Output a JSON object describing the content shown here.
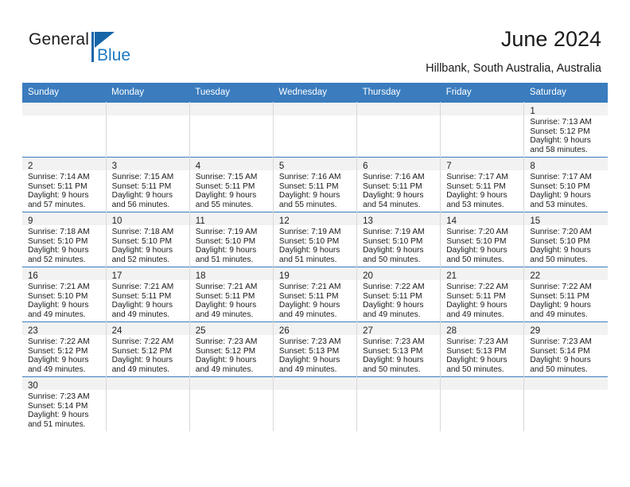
{
  "brand": {
    "word_one": "General",
    "word_two": "Blue",
    "triangle_icon": "triangle-logo-icon",
    "accent_dark": "#1565a8",
    "accent_light": "#1b79c4"
  },
  "header": {
    "title": "June 2024",
    "subtitle": "Hillbank, South Australia, Australia"
  },
  "calendar": {
    "header_bg": "#3a7cbe",
    "daynum_bg": "#f2f2f2",
    "weekday_headers": [
      "Sunday",
      "Monday",
      "Tuesday",
      "Wednesday",
      "Thursday",
      "Friday",
      "Saturday"
    ],
    "weeks": [
      [
        {
          "day": "",
          "sunrise": "",
          "sunset": "",
          "daylight_line1": "",
          "daylight_line2": "",
          "empty": true
        },
        {
          "day": "",
          "sunrise": "",
          "sunset": "",
          "daylight_line1": "",
          "daylight_line2": "",
          "empty": true
        },
        {
          "day": "",
          "sunrise": "",
          "sunset": "",
          "daylight_line1": "",
          "daylight_line2": "",
          "empty": true
        },
        {
          "day": "",
          "sunrise": "",
          "sunset": "",
          "daylight_line1": "",
          "daylight_line2": "",
          "empty": true
        },
        {
          "day": "",
          "sunrise": "",
          "sunset": "",
          "daylight_line1": "",
          "daylight_line2": "",
          "empty": true
        },
        {
          "day": "",
          "sunrise": "",
          "sunset": "",
          "daylight_line1": "",
          "daylight_line2": "",
          "empty": true
        },
        {
          "day": "1",
          "sunrise": "Sunrise: 7:13 AM",
          "sunset": "Sunset: 5:12 PM",
          "daylight_line1": "Daylight: 9 hours",
          "daylight_line2": "and 58 minutes.",
          "empty": false
        }
      ],
      [
        {
          "day": "2",
          "sunrise": "Sunrise: 7:14 AM",
          "sunset": "Sunset: 5:11 PM",
          "daylight_line1": "Daylight: 9 hours",
          "daylight_line2": "and 57 minutes.",
          "empty": false
        },
        {
          "day": "3",
          "sunrise": "Sunrise: 7:15 AM",
          "sunset": "Sunset: 5:11 PM",
          "daylight_line1": "Daylight: 9 hours",
          "daylight_line2": "and 56 minutes.",
          "empty": false
        },
        {
          "day": "4",
          "sunrise": "Sunrise: 7:15 AM",
          "sunset": "Sunset: 5:11 PM",
          "daylight_line1": "Daylight: 9 hours",
          "daylight_line2": "and 55 minutes.",
          "empty": false
        },
        {
          "day": "5",
          "sunrise": "Sunrise: 7:16 AM",
          "sunset": "Sunset: 5:11 PM",
          "daylight_line1": "Daylight: 9 hours",
          "daylight_line2": "and 55 minutes.",
          "empty": false
        },
        {
          "day": "6",
          "sunrise": "Sunrise: 7:16 AM",
          "sunset": "Sunset: 5:11 PM",
          "daylight_line1": "Daylight: 9 hours",
          "daylight_line2": "and 54 minutes.",
          "empty": false
        },
        {
          "day": "7",
          "sunrise": "Sunrise: 7:17 AM",
          "sunset": "Sunset: 5:11 PM",
          "daylight_line1": "Daylight: 9 hours",
          "daylight_line2": "and 53 minutes.",
          "empty": false
        },
        {
          "day": "8",
          "sunrise": "Sunrise: 7:17 AM",
          "sunset": "Sunset: 5:10 PM",
          "daylight_line1": "Daylight: 9 hours",
          "daylight_line2": "and 53 minutes.",
          "empty": false
        }
      ],
      [
        {
          "day": "9",
          "sunrise": "Sunrise: 7:18 AM",
          "sunset": "Sunset: 5:10 PM",
          "daylight_line1": "Daylight: 9 hours",
          "daylight_line2": "and 52 minutes.",
          "empty": false
        },
        {
          "day": "10",
          "sunrise": "Sunrise: 7:18 AM",
          "sunset": "Sunset: 5:10 PM",
          "daylight_line1": "Daylight: 9 hours",
          "daylight_line2": "and 52 minutes.",
          "empty": false
        },
        {
          "day": "11",
          "sunrise": "Sunrise: 7:19 AM",
          "sunset": "Sunset: 5:10 PM",
          "daylight_line1": "Daylight: 9 hours",
          "daylight_line2": "and 51 minutes.",
          "empty": false
        },
        {
          "day": "12",
          "sunrise": "Sunrise: 7:19 AM",
          "sunset": "Sunset: 5:10 PM",
          "daylight_line1": "Daylight: 9 hours",
          "daylight_line2": "and 51 minutes.",
          "empty": false
        },
        {
          "day": "13",
          "sunrise": "Sunrise: 7:19 AM",
          "sunset": "Sunset: 5:10 PM",
          "daylight_line1": "Daylight: 9 hours",
          "daylight_line2": "and 50 minutes.",
          "empty": false
        },
        {
          "day": "14",
          "sunrise": "Sunrise: 7:20 AM",
          "sunset": "Sunset: 5:10 PM",
          "daylight_line1": "Daylight: 9 hours",
          "daylight_line2": "and 50 minutes.",
          "empty": false
        },
        {
          "day": "15",
          "sunrise": "Sunrise: 7:20 AM",
          "sunset": "Sunset: 5:10 PM",
          "daylight_line1": "Daylight: 9 hours",
          "daylight_line2": "and 50 minutes.",
          "empty": false
        }
      ],
      [
        {
          "day": "16",
          "sunrise": "Sunrise: 7:21 AM",
          "sunset": "Sunset: 5:10 PM",
          "daylight_line1": "Daylight: 9 hours",
          "daylight_line2": "and 49 minutes.",
          "empty": false
        },
        {
          "day": "17",
          "sunrise": "Sunrise: 7:21 AM",
          "sunset": "Sunset: 5:11 PM",
          "daylight_line1": "Daylight: 9 hours",
          "daylight_line2": "and 49 minutes.",
          "empty": false
        },
        {
          "day": "18",
          "sunrise": "Sunrise: 7:21 AM",
          "sunset": "Sunset: 5:11 PM",
          "daylight_line1": "Daylight: 9 hours",
          "daylight_line2": "and 49 minutes.",
          "empty": false
        },
        {
          "day": "19",
          "sunrise": "Sunrise: 7:21 AM",
          "sunset": "Sunset: 5:11 PM",
          "daylight_line1": "Daylight: 9 hours",
          "daylight_line2": "and 49 minutes.",
          "empty": false
        },
        {
          "day": "20",
          "sunrise": "Sunrise: 7:22 AM",
          "sunset": "Sunset: 5:11 PM",
          "daylight_line1": "Daylight: 9 hours",
          "daylight_line2": "and 49 minutes.",
          "empty": false
        },
        {
          "day": "21",
          "sunrise": "Sunrise: 7:22 AM",
          "sunset": "Sunset: 5:11 PM",
          "daylight_line1": "Daylight: 9 hours",
          "daylight_line2": "and 49 minutes.",
          "empty": false
        },
        {
          "day": "22",
          "sunrise": "Sunrise: 7:22 AM",
          "sunset": "Sunset: 5:11 PM",
          "daylight_line1": "Daylight: 9 hours",
          "daylight_line2": "and 49 minutes.",
          "empty": false
        }
      ],
      [
        {
          "day": "23",
          "sunrise": "Sunrise: 7:22 AM",
          "sunset": "Sunset: 5:12 PM",
          "daylight_line1": "Daylight: 9 hours",
          "daylight_line2": "and 49 minutes.",
          "empty": false
        },
        {
          "day": "24",
          "sunrise": "Sunrise: 7:22 AM",
          "sunset": "Sunset: 5:12 PM",
          "daylight_line1": "Daylight: 9 hours",
          "daylight_line2": "and 49 minutes.",
          "empty": false
        },
        {
          "day": "25",
          "sunrise": "Sunrise: 7:23 AM",
          "sunset": "Sunset: 5:12 PM",
          "daylight_line1": "Daylight: 9 hours",
          "daylight_line2": "and 49 minutes.",
          "empty": false
        },
        {
          "day": "26",
          "sunrise": "Sunrise: 7:23 AM",
          "sunset": "Sunset: 5:13 PM",
          "daylight_line1": "Daylight: 9 hours",
          "daylight_line2": "and 49 minutes.",
          "empty": false
        },
        {
          "day": "27",
          "sunrise": "Sunrise: 7:23 AM",
          "sunset": "Sunset: 5:13 PM",
          "daylight_line1": "Daylight: 9 hours",
          "daylight_line2": "and 50 minutes.",
          "empty": false
        },
        {
          "day": "28",
          "sunrise": "Sunrise: 7:23 AM",
          "sunset": "Sunset: 5:13 PM",
          "daylight_line1": "Daylight: 9 hours",
          "daylight_line2": "and 50 minutes.",
          "empty": false
        },
        {
          "day": "29",
          "sunrise": "Sunrise: 7:23 AM",
          "sunset": "Sunset: 5:14 PM",
          "daylight_line1": "Daylight: 9 hours",
          "daylight_line2": "and 50 minutes.",
          "empty": false
        }
      ],
      [
        {
          "day": "30",
          "sunrise": "Sunrise: 7:23 AM",
          "sunset": "Sunset: 5:14 PM",
          "daylight_line1": "Daylight: 9 hours",
          "daylight_line2": "and 51 minutes.",
          "empty": false
        },
        {
          "day": "",
          "sunrise": "",
          "sunset": "",
          "daylight_line1": "",
          "daylight_line2": "",
          "empty": true
        },
        {
          "day": "",
          "sunrise": "",
          "sunset": "",
          "daylight_line1": "",
          "daylight_line2": "",
          "empty": true
        },
        {
          "day": "",
          "sunrise": "",
          "sunset": "",
          "daylight_line1": "",
          "daylight_line2": "",
          "empty": true
        },
        {
          "day": "",
          "sunrise": "",
          "sunset": "",
          "daylight_line1": "",
          "daylight_line2": "",
          "empty": true
        },
        {
          "day": "",
          "sunrise": "",
          "sunset": "",
          "daylight_line1": "",
          "daylight_line2": "",
          "empty": true
        },
        {
          "day": "",
          "sunrise": "",
          "sunset": "",
          "daylight_line1": "",
          "daylight_line2": "",
          "empty": true
        }
      ]
    ]
  }
}
